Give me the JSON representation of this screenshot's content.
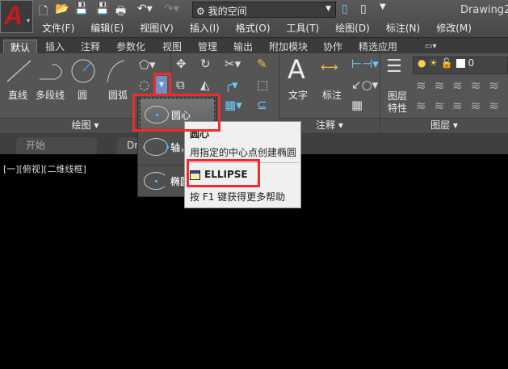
{
  "titlebar": {
    "logo_text": "A",
    "workspace": "我的空间",
    "doc_title": "Drawing2.",
    "quick_access": [
      "new-icon",
      "open-icon",
      "save-icon",
      "save-as-icon",
      "print-icon",
      "undo-icon",
      "redo-icon"
    ]
  },
  "menubar": [
    "文件(F)",
    "编辑(E)",
    "视图(V)",
    "插入(I)",
    "格式(O)",
    "工具(T)",
    "绘图(D)",
    "标注(N)",
    "修改(M)"
  ],
  "ribbon_tabs": [
    "默认",
    "插入",
    "注释",
    "参数化",
    "视图",
    "管理",
    "输出",
    "附加模块",
    "协作",
    "精选应用"
  ],
  "ribbon": {
    "draw": {
      "label": "绘图 ▾",
      "buttons": [
        "直线",
        "多段线",
        "圆",
        "圆弧"
      ]
    },
    "annotation": {
      "label": "注释 ▾",
      "buttons": [
        "文字",
        "标注"
      ]
    },
    "layers": {
      "label": "图层 ▾",
      "properties": "图层\n特性",
      "layer_props_line1": "图层",
      "layer_props_line2": "特性",
      "current_layer": "0"
    }
  },
  "doc_tabs": [
    "开始",
    "Dr"
  ],
  "viewport_label": "[一][俯视][二维线框]",
  "ellipse_dropdown": {
    "items": [
      "圆心",
      "轴，端点",
      "椭圆弧"
    ],
    "visible_items": [
      "圆心",
      "轴",
      "椭圆"
    ]
  },
  "tooltip": {
    "title": "圆心",
    "description": "用指定的中心点创建椭圆",
    "command": "ELLIPSE",
    "help": "按 F1 键获得更多帮助"
  },
  "colors": {
    "highlight": "#f12a2a",
    "accent": "#4aa8ff",
    "logo": "#c8191e"
  }
}
